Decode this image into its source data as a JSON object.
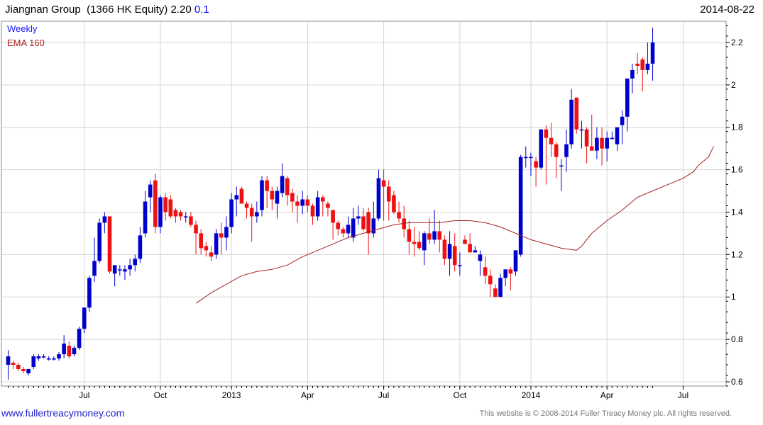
{
  "header": {
    "title_prefix": "Jiangnan Group  (1366 HK Equity) 2.20",
    "change": "0.1",
    "date": "2014-08-22"
  },
  "footer": {
    "site": "www.fullertreacymoney.com",
    "copyright": "This website is © 2008-2014 Fuller Treacy Money plc. All rights reserved."
  },
  "colors": {
    "up": "#0000cc",
    "down": "#ee1111",
    "ema": "#a52020",
    "grid": "#d4d4d4",
    "legend_weekly": "#1a1aff"
  },
  "chart_data": {
    "type": "candlestick",
    "series": [
      {
        "name": "Weekly"
      },
      {
        "name": "EMA 160"
      }
    ],
    "ylim": [
      0.58,
      2.3
    ],
    "y_ticks": [
      "0.6",
      "0.8",
      "1",
      "1.2",
      "1.4",
      "1.6",
      "1.8",
      "2",
      "2.2"
    ],
    "x_ticks": [
      "Jul",
      "Oct",
      "2013",
      "Apr",
      "Jul",
      "Oct",
      "2014",
      "Apr",
      "Jul"
    ],
    "x_tick_week": [
      15,
      30,
      44,
      59,
      74,
      89,
      103,
      118,
      133
    ],
    "candles": [
      [
        0.68,
        0.75,
        0.61,
        0.72
      ],
      [
        0.69,
        0.7,
        0.66,
        0.68
      ],
      [
        0.68,
        0.69,
        0.65,
        0.66
      ],
      [
        0.66,
        0.67,
        0.64,
        0.65
      ],
      [
        0.64,
        0.66,
        0.63,
        0.66
      ],
      [
        0.67,
        0.73,
        0.66,
        0.72
      ],
      [
        0.71,
        0.73,
        0.7,
        0.72
      ],
      [
        0.72,
        0.73,
        0.71,
        0.72
      ],
      [
        0.71,
        0.72,
        0.7,
        0.71
      ],
      [
        0.71,
        0.72,
        0.7,
        0.71
      ],
      [
        0.71,
        0.74,
        0.7,
        0.73
      ],
      [
        0.73,
        0.82,
        0.71,
        0.78
      ],
      [
        0.77,
        0.79,
        0.71,
        0.72
      ],
      [
        0.73,
        0.77,
        0.72,
        0.76
      ],
      [
        0.76,
        0.86,
        0.75,
        0.85
      ],
      [
        0.85,
        0.92,
        0.83,
        0.95
      ],
      [
        0.95,
        1.1,
        0.93,
        1.09
      ],
      [
        1.1,
        1.28,
        1.07,
        1.17
      ],
      [
        1.17,
        1.37,
        1.16,
        1.35
      ],
      [
        1.35,
        1.4,
        1.3,
        1.38
      ],
      [
        1.38,
        1.37,
        1.11,
        1.12
      ],
      [
        1.11,
        1.14,
        1.05,
        1.15
      ],
      [
        1.13,
        1.15,
        1.1,
        1.13
      ],
      [
        1.12,
        1.15,
        1.08,
        1.13
      ],
      [
        1.13,
        1.18,
        1.1,
        1.15
      ],
      [
        1.15,
        1.2,
        1.12,
        1.18
      ],
      [
        1.18,
        1.33,
        1.16,
        1.29
      ],
      [
        1.3,
        1.5,
        1.28,
        1.45
      ],
      [
        1.47,
        1.55,
        1.4,
        1.53
      ],
      [
        1.55,
        1.58,
        1.3,
        1.33
      ],
      [
        1.33,
        1.48,
        1.3,
        1.47
      ],
      [
        1.47,
        1.49,
        1.36,
        1.4
      ],
      [
        1.46,
        1.48,
        1.37,
        1.38
      ],
      [
        1.41,
        1.42,
        1.35,
        1.38
      ],
      [
        1.4,
        1.41,
        1.36,
        1.38
      ],
      [
        1.38,
        1.4,
        1.35,
        1.38
      ],
      [
        1.38,
        1.4,
        1.33,
        1.34
      ],
      [
        1.34,
        1.36,
        1.2,
        1.3
      ],
      [
        1.3,
        1.32,
        1.2,
        1.23
      ],
      [
        1.24,
        1.26,
        1.19,
        1.22
      ],
      [
        1.21,
        1.24,
        1.17,
        1.19
      ],
      [
        1.2,
        1.32,
        1.18,
        1.3
      ],
      [
        1.3,
        1.35,
        1.2,
        1.28
      ],
      [
        1.28,
        1.38,
        1.22,
        1.33
      ],
      [
        1.33,
        1.49,
        1.3,
        1.46
      ],
      [
        1.46,
        1.52,
        1.38,
        1.48
      ],
      [
        1.51,
        1.52,
        1.45,
        1.44
      ],
      [
        1.44,
        1.45,
        1.37,
        1.42
      ],
      [
        1.42,
        1.44,
        1.26,
        1.38
      ],
      [
        1.38,
        1.45,
        1.35,
        1.4
      ],
      [
        1.41,
        1.57,
        1.38,
        1.55
      ],
      [
        1.55,
        1.57,
        1.42,
        1.5
      ],
      [
        1.5,
        1.52,
        1.41,
        1.46
      ],
      [
        1.44,
        1.52,
        1.37,
        1.5
      ],
      [
        1.49,
        1.63,
        1.47,
        1.57
      ],
      [
        1.56,
        1.57,
        1.43,
        1.48
      ],
      [
        1.49,
        1.51,
        1.4,
        1.45
      ],
      [
        1.45,
        1.48,
        1.35,
        1.43
      ],
      [
        1.43,
        1.5,
        1.39,
        1.46
      ],
      [
        1.46,
        1.48,
        1.4,
        1.43
      ],
      [
        1.43,
        1.44,
        1.34,
        1.38
      ],
      [
        1.38,
        1.5,
        1.36,
        1.47
      ],
      [
        1.47,
        1.48,
        1.38,
        1.45
      ],
      [
        1.44,
        1.45,
        1.38,
        1.42
      ],
      [
        1.41,
        1.4,
        1.27,
        1.35
      ],
      [
        1.35,
        1.36,
        1.29,
        1.32
      ],
      [
        1.32,
        1.33,
        1.28,
        1.3
      ],
      [
        1.3,
        1.38,
        1.28,
        1.34
      ],
      [
        1.28,
        1.42,
        1.26,
        1.37
      ],
      [
        1.37,
        1.43,
        1.34,
        1.38
      ],
      [
        1.38,
        1.42,
        1.31,
        1.32
      ],
      [
        1.4,
        1.42,
        1.2,
        1.3
      ],
      [
        1.3,
        1.45,
        1.28,
        1.37
      ],
      [
        1.37,
        1.6,
        1.36,
        1.56
      ],
      [
        1.55,
        1.6,
        1.36,
        1.52
      ],
      [
        1.52,
        1.55,
        1.36,
        1.45
      ],
      [
        1.48,
        1.5,
        1.39,
        1.4
      ],
      [
        1.4,
        1.45,
        1.35,
        1.37
      ],
      [
        1.37,
        1.43,
        1.28,
        1.32
      ],
      [
        1.32,
        1.36,
        1.2,
        1.26
      ],
      [
        1.26,
        1.33,
        1.19,
        1.25
      ],
      [
        1.26,
        1.31,
        1.22,
        1.23
      ],
      [
        1.22,
        1.31,
        1.15,
        1.3
      ],
      [
        1.3,
        1.37,
        1.25,
        1.27
      ],
      [
        1.27,
        1.41,
        1.25,
        1.31
      ],
      [
        1.31,
        1.36,
        1.21,
        1.27
      ],
      [
        1.27,
        1.29,
        1.15,
        1.18
      ],
      [
        1.18,
        1.31,
        1.1,
        1.25
      ],
      [
        1.24,
        1.3,
        1.12,
        1.15
      ],
      [
        1.15,
        1.21,
        1.1,
        1.15
      ],
      [
        1.27,
        1.29,
        1.25,
        1.25
      ],
      [
        1.25,
        1.3,
        1.22,
        1.21
      ],
      [
        1.21,
        1.24,
        1.21,
        1.22
      ],
      [
        1.17,
        1.22,
        1.1,
        1.2
      ],
      [
        1.14,
        1.19,
        1.06,
        1.1
      ],
      [
        1.1,
        1.13,
        1.0,
        1.06
      ],
      [
        1.04,
        1.06,
        1.0,
        1.0
      ],
      [
        1.0,
        1.11,
        1.0,
        1.09
      ],
      [
        1.09,
        1.13,
        1.05,
        1.13
      ],
      [
        1.13,
        1.14,
        1.03,
        1.11
      ],
      [
        1.12,
        1.2,
        1.1,
        1.22
      ],
      [
        1.2,
        1.67,
        1.19,
        1.66
      ],
      [
        1.66,
        1.71,
        1.61,
        1.66
      ],
      [
        1.66,
        1.68,
        1.57,
        1.66
      ],
      [
        1.64,
        1.66,
        1.52,
        1.61
      ],
      [
        1.61,
        1.79,
        1.6,
        1.79
      ],
      [
        1.79,
        1.81,
        1.53,
        1.75
      ],
      [
        1.75,
        1.82,
        1.66,
        1.72
      ],
      [
        1.72,
        1.73,
        1.56,
        1.66
      ],
      [
        1.62,
        1.65,
        1.5,
        1.62
      ],
      [
        1.66,
        1.79,
        1.59,
        1.72
      ],
      [
        1.72,
        1.98,
        1.7,
        1.93
      ],
      [
        1.94,
        1.94,
        1.77,
        1.79
      ],
      [
        1.79,
        1.83,
        1.7,
        1.79
      ],
      [
        1.79,
        1.8,
        1.63,
        1.71
      ],
      [
        1.71,
        1.86,
        1.69,
        1.69
      ],
      [
        1.69,
        1.8,
        1.65,
        1.75
      ],
      [
        1.75,
        1.8,
        1.62,
        1.7
      ],
      [
        1.7,
        1.78,
        1.64,
        1.75
      ],
      [
        1.75,
        1.78,
        1.74,
        1.75
      ],
      [
        1.72,
        1.79,
        1.69,
        1.8
      ],
      [
        1.81,
        1.88,
        1.72,
        1.85
      ],
      [
        1.85,
        1.95,
        1.78,
        2.03
      ],
      [
        2.03,
        2.1,
        1.96,
        2.07
      ],
      [
        2.1,
        2.15,
        2.05,
        2.09
      ],
      [
        2.12,
        2.13,
        1.97,
        2.07
      ],
      [
        2.07,
        2.2,
        2.05,
        2.1
      ],
      [
        2.1,
        2.27,
        2.02,
        2.2
      ]
    ],
    "ema": [
      [
        37,
        0.97
      ],
      [
        40,
        1.02
      ],
      [
        43,
        1.06
      ],
      [
        46,
        1.1
      ],
      [
        49,
        1.12
      ],
      [
        52,
        1.13
      ],
      [
        55,
        1.15
      ],
      [
        58,
        1.19
      ],
      [
        61,
        1.22
      ],
      [
        64,
        1.25
      ],
      [
        67,
        1.28
      ],
      [
        70,
        1.3
      ],
      [
        73,
        1.32
      ],
      [
        76,
        1.34
      ],
      [
        79,
        1.35
      ],
      [
        82,
        1.35
      ],
      [
        85,
        1.35
      ],
      [
        88,
        1.36
      ],
      [
        91,
        1.36
      ],
      [
        94,
        1.35
      ],
      [
        97,
        1.33
      ],
      [
        100,
        1.3
      ],
      [
        103,
        1.27
      ],
      [
        106,
        1.25
      ],
      [
        109,
        1.23
      ],
      [
        112,
        1.22
      ],
      [
        113,
        1.24
      ],
      [
        115,
        1.3
      ],
      [
        118,
        1.36
      ],
      [
        121,
        1.41
      ],
      [
        124,
        1.47
      ],
      [
        127,
        1.5
      ],
      [
        130,
        1.53
      ],
      [
        133,
        1.56
      ],
      [
        135,
        1.59
      ],
      [
        136,
        1.62
      ],
      [
        138,
        1.66
      ],
      [
        139,
        1.71
      ]
    ]
  }
}
